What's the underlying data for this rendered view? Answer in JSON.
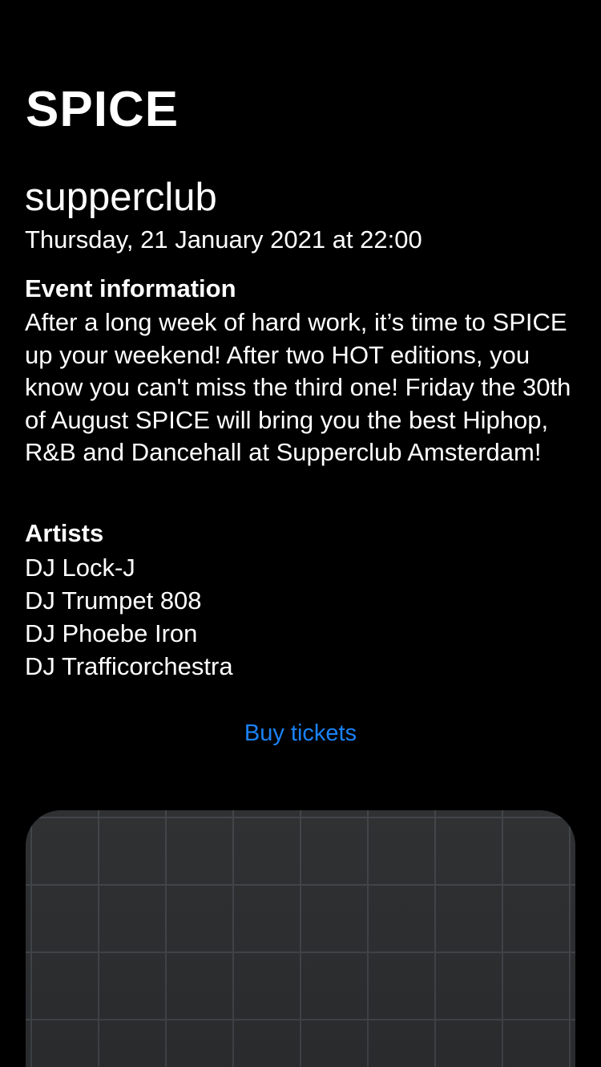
{
  "app": {
    "title": "SPICE"
  },
  "event": {
    "venue": "supperclub",
    "datetime": "Thursday, 21 January 2021 at 22:00",
    "info_heading": "Event information",
    "info_body": "After a long week of hard work, it’s time to SPICE up your weekend! After two HOT editions, you know you can't miss the third one! Friday the 30th of August SPICE will bring you the best Hiphop, R&B and Dancehall at Supperclub Amsterdam!",
    "artists_heading": "Artists",
    "artists": [
      "DJ Lock-J",
      "DJ Trumpet 808",
      "DJ Phoebe Iron",
      "DJ Trafficorchestra"
    ]
  },
  "actions": {
    "buy_tickets": "Buy tickets"
  },
  "colors": {
    "background": "#000000",
    "text": "#ffffff",
    "link": "#1a82f7",
    "map_surface": "#2b2d2f",
    "map_grid": "#3f4346"
  }
}
